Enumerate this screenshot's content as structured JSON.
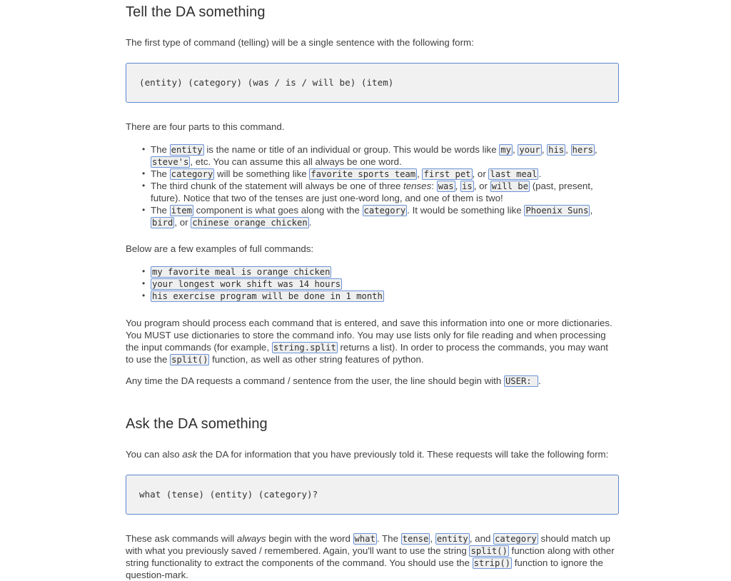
{
  "document": {
    "sections": [
      {
        "heading": "Tell the DA something",
        "intro": "The first type of command (telling) will be a single sentence with the following form:",
        "code_block": "(entity) (category) (was / is / will be) (item)",
        "after_code": "There are four parts to this command.",
        "bullets": [
          {
            "parts": [
              {
                "t": "text",
                "v": "The "
              },
              {
                "t": "code",
                "v": "entity"
              },
              {
                "t": "text",
                "v": " is the name or title of an individual or group. This would be words like "
              },
              {
                "t": "code",
                "v": "my"
              },
              {
                "t": "text",
                "v": ", "
              },
              {
                "t": "code",
                "v": "your"
              },
              {
                "t": "text",
                "v": ", "
              },
              {
                "t": "code",
                "v": "his"
              },
              {
                "t": "text",
                "v": ", "
              },
              {
                "t": "code",
                "v": "hers"
              },
              {
                "t": "text",
                "v": ", "
              },
              {
                "t": "code",
                "v": "steve's"
              },
              {
                "t": "text",
                "v": ", etc. You can assume this all always be one word."
              }
            ]
          },
          {
            "parts": [
              {
                "t": "text",
                "v": "The "
              },
              {
                "t": "code",
                "v": "category"
              },
              {
                "t": "text",
                "v": " will be something like "
              },
              {
                "t": "code",
                "v": "favorite sports team"
              },
              {
                "t": "text",
                "v": ", "
              },
              {
                "t": "code",
                "v": "first pet"
              },
              {
                "t": "text",
                "v": ", or "
              },
              {
                "t": "code",
                "v": "last meal"
              },
              {
                "t": "text",
                "v": "."
              }
            ]
          },
          {
            "parts": [
              {
                "t": "text",
                "v": "The third chunk of the statement will always be one of three "
              },
              {
                "t": "em",
                "v": "tenses"
              },
              {
                "t": "text",
                "v": ": "
              },
              {
                "t": "code",
                "v": "was"
              },
              {
                "t": "text",
                "v": ", "
              },
              {
                "t": "code",
                "v": "is"
              },
              {
                "t": "text",
                "v": ", or "
              },
              {
                "t": "code",
                "v": "will be"
              },
              {
                "t": "text",
                "v": " (past, present, future). Notice that two of the tenses are just one-word long, and one of them is two!"
              }
            ]
          },
          {
            "parts": [
              {
                "t": "text",
                "v": "The "
              },
              {
                "t": "code",
                "v": "item"
              },
              {
                "t": "text",
                "v": " component is what goes along with the "
              },
              {
                "t": "code",
                "v": "category"
              },
              {
                "t": "text",
                "v": ". It would be something like "
              },
              {
                "t": "code",
                "v": "Phoenix Suns"
              },
              {
                "t": "text",
                "v": ", "
              },
              {
                "t": "code",
                "v": "bird"
              },
              {
                "t": "text",
                "v": ", or "
              },
              {
                "t": "code",
                "v": "chinese orange chicken"
              },
              {
                "t": "text",
                "v": "."
              }
            ]
          }
        ],
        "examples_intro": "Below are a few examples of full commands:",
        "examples": [
          "my favorite meal is orange chicken",
          "your longest work shift was 14 hours",
          "his exercise program will be done in 1 month"
        ],
        "paragraph_1": [
          {
            "t": "text",
            "v": "You program should process each command that is entered, and save this information into one or more dictionaries. You MUST use dictionaries to store the command info. You may use lists only for file reading and when processing the input commands (for example, "
          },
          {
            "t": "code",
            "v": "string.split"
          },
          {
            "t": "text",
            "v": " returns a list). In order to process the commands, you may want to use the "
          },
          {
            "t": "code",
            "v": "split()"
          },
          {
            "t": "text",
            "v": " function, as well as other string features of python."
          }
        ],
        "paragraph_2": [
          {
            "t": "text",
            "v": "Any time the DA requests a command / sentence from the user, the line should begin with "
          },
          {
            "t": "code",
            "v": "USER: "
          },
          {
            "t": "text",
            "v": "."
          }
        ]
      },
      {
        "heading": "Ask the DA something",
        "intro": [
          {
            "t": "text",
            "v": "You can also "
          },
          {
            "t": "em",
            "v": "ask"
          },
          {
            "t": "text",
            "v": " the DA for information that you have previously told it. These requests will take the following form:"
          }
        ],
        "code_block": "what (tense) (entity) (category)?",
        "paragraph_1": [
          {
            "t": "text",
            "v": "These ask commands will "
          },
          {
            "t": "em",
            "v": "always"
          },
          {
            "t": "text",
            "v": " begin with the word "
          },
          {
            "t": "code",
            "v": "what"
          },
          {
            "t": "text",
            "v": ". The "
          },
          {
            "t": "code",
            "v": "tense"
          },
          {
            "t": "text",
            "v": ", "
          },
          {
            "t": "code",
            "v": "entity"
          },
          {
            "t": "text",
            "v": ", and "
          },
          {
            "t": "code",
            "v": "category"
          },
          {
            "t": "text",
            "v": " should match up with what you previously saved / remembered. Again, you'll want to use the string "
          },
          {
            "t": "code",
            "v": "split()"
          },
          {
            "t": "text",
            "v": " function along with other string functionality to extract the components of the command. You should use the "
          },
          {
            "t": "code",
            "v": "strip()"
          },
          {
            "t": "text",
            "v": " function to ignore the question-mark."
          }
        ]
      }
    ],
    "colors": {
      "code_border": "#5b87cf",
      "code_background": "#f1f1f1",
      "inline_code_border": "#6b93d6",
      "inline_code_background": "#efefef",
      "text": "#3f3f3f",
      "heading": "#2f2f2f"
    }
  }
}
